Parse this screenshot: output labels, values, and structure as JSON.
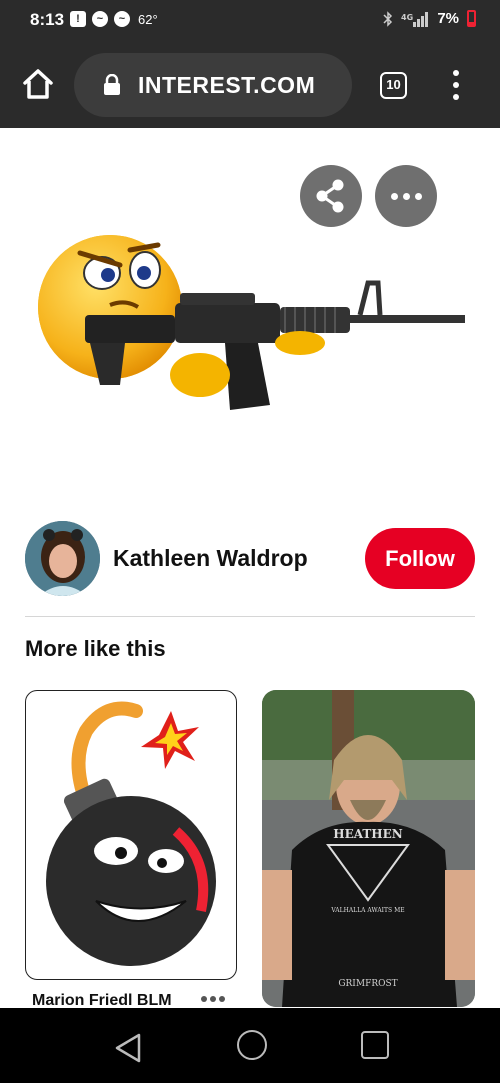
{
  "status_bar": {
    "time": "8:13",
    "temperature": "62°",
    "battery": "7%",
    "icons_left": [
      "alert-icon",
      "messenger-icon",
      "messenger-icon"
    ],
    "icons_right": [
      "bluetooth-icon",
      "signal-icon",
      "battery-icon"
    ]
  },
  "browser": {
    "url": "INTEREST.COM",
    "tab_count": "10"
  },
  "pin": {
    "image_description_icon": "emoji-with-rifle-image"
  },
  "creator": {
    "name": "Kathleen Waldrop",
    "follow_label": "Follow"
  },
  "more_like_this": {
    "title": "More like this",
    "cards": [
      {
        "caption": "Marion Friedl BLM"
      },
      {
        "caption": "",
        "shirt_text": [
          "HEATHEN",
          "VALHALLA AWAITS ME",
          "GRIMFROST"
        ]
      }
    ]
  },
  "colors": {
    "follow": "#e60023",
    "toolbar": "#2b2b2b",
    "circle_button": "#6f6f6f"
  }
}
